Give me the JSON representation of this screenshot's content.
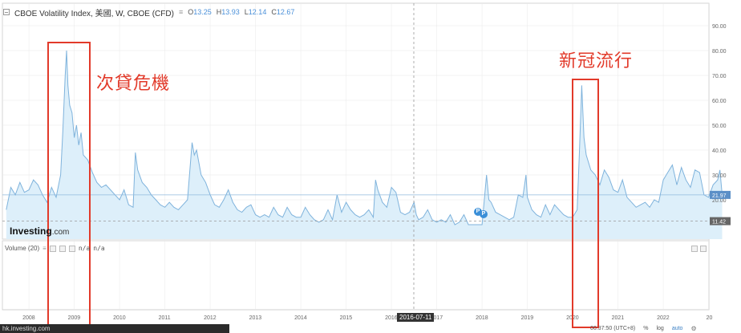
{
  "header": {
    "symbol_title": "CBOE Volatility Index, 美國, W, CBOE (CFD)",
    "settings_glyph": "≡",
    "open_label": "O",
    "open_value": "13.25",
    "high_label": "H",
    "high_value": "13.93",
    "low_label": "L",
    "low_value": "12.14",
    "close_label": "C",
    "close_value": "12.67"
  },
  "logo": {
    "brand": "Investing",
    "domain": ".com"
  },
  "volume": {
    "label": "Volume (20)",
    "value1": "n/a",
    "value2": "n/a"
  },
  "annotations": {
    "left_label": "次貸危機",
    "right_label": "新冠流行",
    "color": "#e23a2a"
  },
  "markers": {
    "marker1": "P",
    "marker2": "P"
  },
  "cursor": {
    "date": "2016-07-11"
  },
  "status_url": "hk.investing.com",
  "toolbar": {
    "time": "00:37:50 (UTC+8)",
    "percent": "%",
    "log": "log",
    "auto": "auto"
  },
  "colors": {
    "line": "#7fb3dc",
    "fill": "#ddeffa",
    "grid": "#e8e8e8",
    "price_badge": "#5b8fc7",
    "low_badge": "#666666"
  },
  "chart_data": {
    "type": "area",
    "title": "CBOE Volatility Index, 美國, W, CBOE (CFD)",
    "y_ticks": [
      "90.00",
      "80.00",
      "70.00",
      "60.00",
      "50.00",
      "40.00",
      "30.00",
      "20.00"
    ],
    "x_ticks": [
      "2008",
      "2009",
      "2010",
      "2011",
      "2012",
      "2013",
      "2014",
      "2015",
      "2016",
      "2017",
      "2018",
      "2019",
      "2020",
      "2021",
      "2022",
      "20"
    ],
    "ylim": [
      5,
      95
    ],
    "last_price_label": "21.97",
    "low_level_label": "11.42",
    "points": [
      [
        2007.5,
        16
      ],
      [
        2007.6,
        25
      ],
      [
        2007.7,
        22
      ],
      [
        2007.8,
        27
      ],
      [
        2007.9,
        23
      ],
      [
        2008.0,
        24
      ],
      [
        2008.1,
        28
      ],
      [
        2008.2,
        26
      ],
      [
        2008.3,
        22
      ],
      [
        2008.4,
        19
      ],
      [
        2008.5,
        25
      ],
      [
        2008.6,
        21
      ],
      [
        2008.7,
        30
      ],
      [
        2008.75,
        48
      ],
      [
        2008.8,
        70
      ],
      [
        2008.83,
        80
      ],
      [
        2008.86,
        66
      ],
      [
        2008.9,
        58
      ],
      [
        2008.95,
        55
      ],
      [
        2009.0,
        45
      ],
      [
        2009.05,
        50
      ],
      [
        2009.1,
        42
      ],
      [
        2009.15,
        47
      ],
      [
        2009.2,
        38
      ],
      [
        2009.3,
        36
      ],
      [
        2009.4,
        31
      ],
      [
        2009.5,
        27
      ],
      [
        2009.6,
        25
      ],
      [
        2009.7,
        26
      ],
      [
        2009.8,
        24
      ],
      [
        2009.9,
        22
      ],
      [
        2010.0,
        20
      ],
      [
        2010.1,
        24
      ],
      [
        2010.2,
        18
      ],
      [
        2010.3,
        17
      ],
      [
        2010.35,
        39
      ],
      [
        2010.4,
        32
      ],
      [
        2010.5,
        27
      ],
      [
        2010.6,
        25
      ],
      [
        2010.7,
        22
      ],
      [
        2010.8,
        20
      ],
      [
        2010.9,
        18
      ],
      [
        2011.0,
        17
      ],
      [
        2011.1,
        19
      ],
      [
        2011.2,
        17
      ],
      [
        2011.3,
        16
      ],
      [
        2011.4,
        18
      ],
      [
        2011.5,
        20
      ],
      [
        2011.6,
        43
      ],
      [
        2011.65,
        38
      ],
      [
        2011.7,
        40
      ],
      [
        2011.8,
        30
      ],
      [
        2011.9,
        27
      ],
      [
        2012.0,
        22
      ],
      [
        2012.1,
        18
      ],
      [
        2012.2,
        17
      ],
      [
        2012.3,
        20
      ],
      [
        2012.4,
        24
      ],
      [
        2012.5,
        19
      ],
      [
        2012.6,
        16
      ],
      [
        2012.7,
        15
      ],
      [
        2012.8,
        17
      ],
      [
        2012.9,
        18
      ],
      [
        2013.0,
        14
      ],
      [
        2013.1,
        13
      ],
      [
        2013.2,
        14
      ],
      [
        2013.3,
        13
      ],
      [
        2013.4,
        17
      ],
      [
        2013.5,
        14
      ],
      [
        2013.6,
        13
      ],
      [
        2013.7,
        17
      ],
      [
        2013.8,
        14
      ],
      [
        2013.9,
        13
      ],
      [
        2014.0,
        13
      ],
      [
        2014.1,
        17
      ],
      [
        2014.2,
        14
      ],
      [
        2014.3,
        12
      ],
      [
        2014.4,
        11
      ],
      [
        2014.5,
        12
      ],
      [
        2014.6,
        16
      ],
      [
        2014.7,
        12
      ],
      [
        2014.8,
        22
      ],
      [
        2014.9,
        15
      ],
      [
        2015.0,
        19
      ],
      [
        2015.1,
        16
      ],
      [
        2015.2,
        14
      ],
      [
        2015.3,
        13
      ],
      [
        2015.4,
        14
      ],
      [
        2015.5,
        16
      ],
      [
        2015.6,
        13
      ],
      [
        2015.65,
        28
      ],
      [
        2015.7,
        24
      ],
      [
        2015.8,
        19
      ],
      [
        2015.9,
        17
      ],
      [
        2016.0,
        25
      ],
      [
        2016.1,
        23
      ],
      [
        2016.2,
        15
      ],
      [
        2016.3,
        14
      ],
      [
        2016.4,
        15
      ],
      [
        2016.5,
        19
      ],
      [
        2016.55,
        14
      ],
      [
        2016.6,
        12
      ],
      [
        2016.7,
        13
      ],
      [
        2016.8,
        16
      ],
      [
        2016.9,
        12
      ],
      [
        2017.0,
        11
      ],
      [
        2017.1,
        12
      ],
      [
        2017.2,
        11
      ],
      [
        2017.3,
        14
      ],
      [
        2017.4,
        10
      ],
      [
        2017.5,
        11
      ],
      [
        2017.6,
        14
      ],
      [
        2017.7,
        10
      ],
      [
        2017.8,
        10
      ],
      [
        2017.9,
        10
      ],
      [
        2018.0,
        10
      ],
      [
        2018.1,
        30
      ],
      [
        2018.15,
        20
      ],
      [
        2018.2,
        19
      ],
      [
        2018.3,
        15
      ],
      [
        2018.4,
        14
      ],
      [
        2018.5,
        13
      ],
      [
        2018.6,
        12
      ],
      [
        2018.7,
        13
      ],
      [
        2018.8,
        22
      ],
      [
        2018.9,
        21
      ],
      [
        2018.97,
        30
      ],
      [
        2019.0,
        21
      ],
      [
        2019.1,
        16
      ],
      [
        2019.2,
        14
      ],
      [
        2019.3,
        13
      ],
      [
        2019.4,
        18
      ],
      [
        2019.5,
        14
      ],
      [
        2019.6,
        18
      ],
      [
        2019.7,
        16
      ],
      [
        2019.8,
        14
      ],
      [
        2019.9,
        13
      ],
      [
        2020.0,
        13
      ],
      [
        2020.1,
        16
      ],
      [
        2020.15,
        40
      ],
      [
        2020.2,
        66
      ],
      [
        2020.25,
        45
      ],
      [
        2020.3,
        38
      ],
      [
        2020.4,
        32
      ],
      [
        2020.5,
        30
      ],
      [
        2020.6,
        26
      ],
      [
        2020.7,
        32
      ],
      [
        2020.8,
        29
      ],
      [
        2020.9,
        24
      ],
      [
        2021.0,
        23
      ],
      [
        2021.1,
        28
      ],
      [
        2021.2,
        21
      ],
      [
        2021.3,
        19
      ],
      [
        2021.4,
        17
      ],
      [
        2021.5,
        18
      ],
      [
        2021.6,
        19
      ],
      [
        2021.7,
        17
      ],
      [
        2021.8,
        20
      ],
      [
        2021.9,
        19
      ],
      [
        2022.0,
        28
      ],
      [
        2022.1,
        31
      ],
      [
        2022.2,
        34
      ],
      [
        2022.3,
        26
      ],
      [
        2022.4,
        33
      ],
      [
        2022.5,
        28
      ],
      [
        2022.6,
        25
      ],
      [
        2022.7,
        32
      ],
      [
        2022.8,
        31
      ],
      [
        2022.9,
        22
      ],
      [
        2023.0,
        21
      ],
      [
        2023.1,
        26
      ],
      [
        2023.2,
        28
      ],
      [
        2023.25,
        32
      ],
      [
        2023.3,
        22
      ]
    ]
  }
}
